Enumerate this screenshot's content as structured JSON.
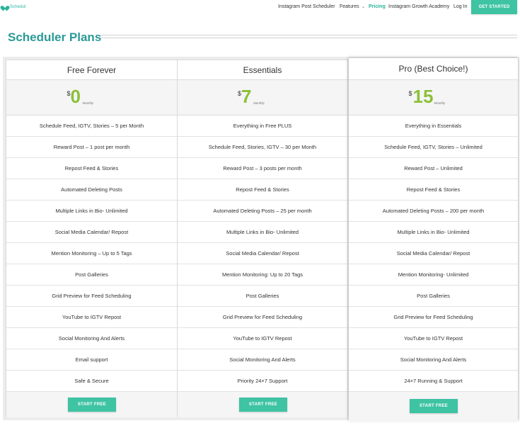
{
  "brand": {
    "name": "Schedul",
    "accent": "#3ec3a3",
    "title_color": "#2a9a96",
    "price_color": "#8cc03a"
  },
  "nav": {
    "items": [
      {
        "label": "Instagram Post Scheduler",
        "active": false
      },
      {
        "label": "Features",
        "active": false,
        "has_caret": true
      },
      {
        "label": "Pricing",
        "active": true
      },
      {
        "label": "Instagram Growth Academy",
        "active": false
      },
      {
        "label": "Log In",
        "active": false
      }
    ],
    "caret": "⌄",
    "cta": "GET STARTED"
  },
  "page": {
    "title": "Scheduler Plans"
  },
  "plans": [
    {
      "name": "Free Forever",
      "currency": "$",
      "price": "0",
      "period": "Monthly",
      "features": [
        "Schedule Feed, IGTV, Stories – 5 per Month",
        "Reward Post – 1 post per month",
        "Repost Feed & Stories",
        "Automated Deleting Posts",
        "Multiple Links in Bio- Unlimited",
        "Social Media Calendar/ Repost",
        "Mention Monitoring – Up to 5 Tags",
        "Post Galleries",
        "Grid Preview for Feed Scheduling",
        "YouTube to IGTV Repost",
        "Social Monitoring And Alerts",
        "Email support",
        "Safe & Secure"
      ],
      "button": "START FREE"
    },
    {
      "name": "Essentials",
      "currency": "$",
      "price": "7",
      "period": "Monthly",
      "features": [
        "Everything in Free PLUS",
        "Schedule Feed, Stories, IGTV – 30 per Month",
        "Reward Post – 3 posts per month",
        "Repost Feed & Stories",
        "Automated Deleting Posts – 25 per month",
        "Multiple Links in Bio- Unlimited",
        "Social Media Calendar/ Repost",
        "Mention Monitoring: Up to 20 Tags",
        "Post Galleries",
        "Grid Preview for Feed Scheduling",
        "YouTube to IGTV Repost",
        "Social Monitoring And Alerts",
        "Priority 24×7 Support"
      ],
      "button": "START FREE"
    },
    {
      "name": "Pro (Best Choice!)",
      "currency": "$",
      "price": "15",
      "period": "Monthly",
      "features": [
        "Everything in Essentials",
        "Schedule Feed, IGTV, Stories – Unlimited",
        "Reward Post – Unlimited",
        "Repost Feed & Stories",
        "Automated Deleting Posts – 200 per month",
        "Multiple Links in Bio- Unlimited",
        "Social Media Calendar/ Repost",
        "Mention Monitoring- Unlimited",
        "Post Galleries",
        "Grid Preview for Feed Scheduling",
        "YouTube to IGTV Repost",
        "Social Monitoring And Alerts",
        "24×7 Running & Support"
      ],
      "button": "START FREE"
    }
  ]
}
